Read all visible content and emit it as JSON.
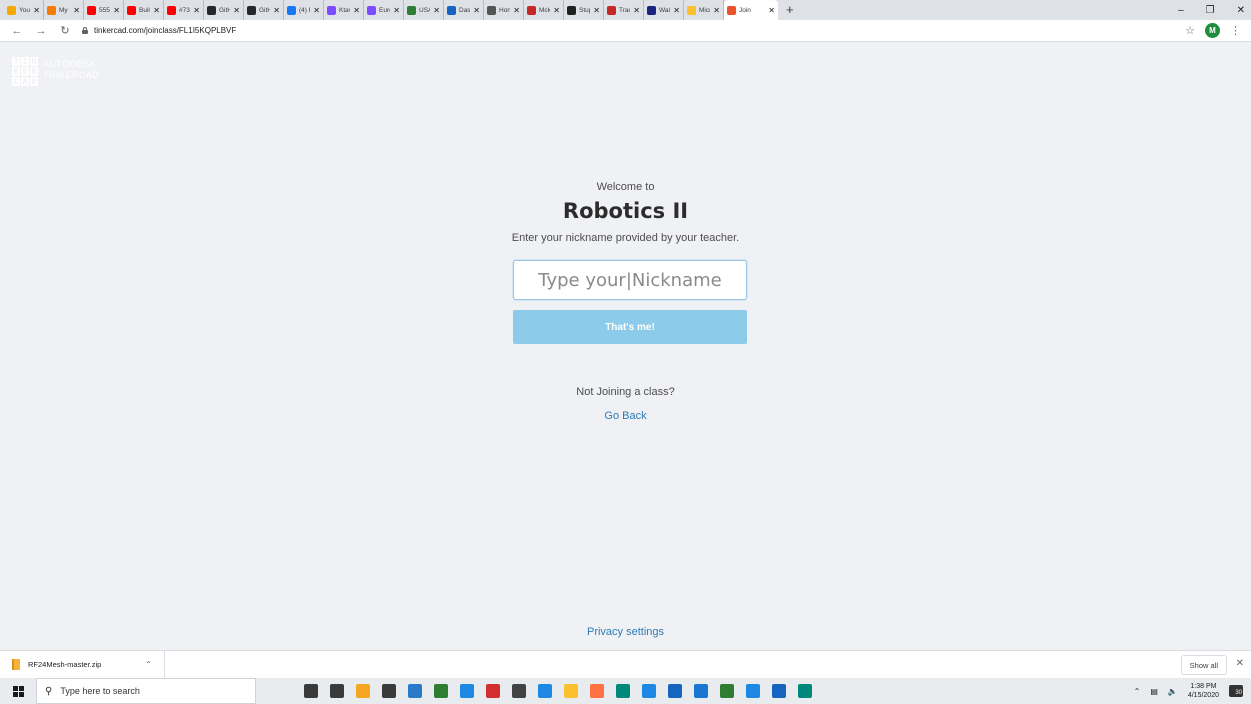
{
  "browser": {
    "tabs": [
      {
        "title": "Your",
        "color": "#f2a900",
        "glyph": "a"
      },
      {
        "title": "My ",
        "color": "#f57c00",
        "glyph": "■"
      },
      {
        "title": "555 ",
        "color": "#ff0000",
        "glyph": "▶"
      },
      {
        "title": "Buil",
        "color": "#ff0000",
        "glyph": "▶"
      },
      {
        "title": "#73 ",
        "color": "#ff0000",
        "glyph": "▶"
      },
      {
        "title": "GitH",
        "color": "#24292e",
        "glyph": "●"
      },
      {
        "title": "GitH",
        "color": "#24292e",
        "glyph": "●"
      },
      {
        "title": "(4) F",
        "color": "#1877f2",
        "glyph": "f"
      },
      {
        "title": "Ktav",
        "color": "#7c4dff",
        "glyph": "✱"
      },
      {
        "title": "Euro",
        "color": "#7c4dff",
        "glyph": "✱"
      },
      {
        "title": "USA",
        "color": "#2e7d32",
        "glyph": "▲"
      },
      {
        "title": "Dasl",
        "color": "#1565c0",
        "glyph": "w"
      },
      {
        "title": "Hon",
        "color": "#555555",
        "glyph": "◎"
      },
      {
        "title": "Mck",
        "color": "#c62828",
        "glyph": "L"
      },
      {
        "title": "Stup",
        "color": "#212121",
        "glyph": "●"
      },
      {
        "title": "Tracl",
        "color": "#c62828",
        "glyph": "●"
      },
      {
        "title": "Walt",
        "color": "#1a237e",
        "glyph": "W"
      },
      {
        "title": "Micr",
        "color": "#fbc02d",
        "glyph": "■"
      },
      {
        "title": "Join",
        "color": "#e8532b",
        "glyph": "▦",
        "active": true
      }
    ],
    "new_tab": "+",
    "url": "tinkercad.com/joinclass/FL1I5KQPLBVF",
    "profile_initial": "M"
  },
  "logo": {
    "grid": [
      "T",
      "I",
      "N",
      "K",
      "E",
      "R",
      "C",
      "A",
      "D"
    ],
    "brand_line1": "AUTODESK",
    "brand_line2": "TINKERCAD"
  },
  "join": {
    "welcome": "Welcome to",
    "class_name": "Robotics II",
    "instructions": "Enter your nickname provided by your teacher.",
    "nickname_placeholder": "Type your|Nickname",
    "nickname_value": "",
    "submit_label": "That's me!",
    "not_joining": "Not Joining a class?",
    "go_back": "Go Back",
    "privacy": "Privacy settings"
  },
  "downloads": {
    "file": "RF24Mesh-master.zip",
    "show_all": "Show all"
  },
  "taskbar": {
    "search_placeholder": "Type here to search",
    "icons": [
      "#3a3a3a",
      "#3a3a3a",
      "#f5a623",
      "#3a3a3a",
      "#2b79c9",
      "#2e7d32",
      "#1e88e5",
      "#d32f2f",
      "#424242",
      "#1e88e5",
      "#fbc02d",
      "#ff7043",
      "#00897b",
      "#1e88e5",
      "#1565c0",
      "#1976d2",
      "#2e7d32",
      "#1e88e5",
      "#1565c0",
      "#00897b"
    ],
    "time": "1:38 PM",
    "date": "4/15/2020",
    "notification_count": "30"
  },
  "colors": {
    "page_bg": "#f0f1f4",
    "button_bg": "#8ccbea",
    "link": "#2e7bb5"
  }
}
